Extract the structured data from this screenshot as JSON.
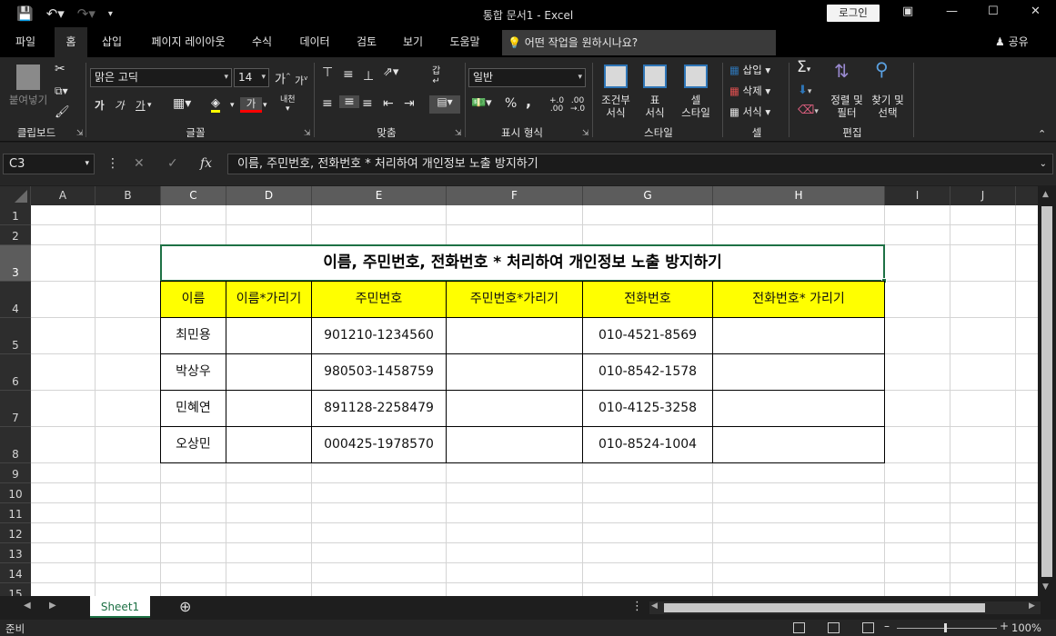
{
  "window": {
    "title": "통합 문서1  -  Excel",
    "login_label": "로그인"
  },
  "quick_access": {
    "icons": [
      "save-icon",
      "undo-icon",
      "redo-icon",
      "customize-icon"
    ]
  },
  "ribbon_tabs": [
    {
      "label": "파일"
    },
    {
      "label": "홈"
    },
    {
      "label": "삽입"
    },
    {
      "label": "페이지 레이아웃"
    },
    {
      "label": "수식"
    },
    {
      "label": "데이터"
    },
    {
      "label": "검토"
    },
    {
      "label": "보기"
    },
    {
      "label": "도움말"
    }
  ],
  "tell_me": "어떤 작업을 원하시나요?",
  "share_label": "공유",
  "ribbon": {
    "clipboard": {
      "paste": "붙여넣기",
      "group": "클립보드"
    },
    "font": {
      "name": "맑은 고딕",
      "size": "14",
      "bold": "가",
      "italic": "가",
      "underline": "가",
      "group": "글꼴",
      "phonetic": "내천"
    },
    "alignment": {
      "wrap": "갑",
      "group": "맞춤"
    },
    "number": {
      "format": "일반",
      "percent": "%",
      "comma": ",",
      "group": "표시 형식"
    },
    "styles": {
      "conditional": "조건부\n서식",
      "table": "표\n서식",
      "cell_style": "셀\n스타일",
      "group": "스타일"
    },
    "cells": {
      "insert": "삽입",
      "delete": "삭제",
      "format": "서식",
      "group": "셀"
    },
    "editing": {
      "sort": "정렬 및\n필터",
      "find": "찾기 및\n선택",
      "group": "편집"
    }
  },
  "formula_bar": {
    "name_box": "C3",
    "formula": "이름, 주민번호, 전화번호 * 처리하여 개인정보 노출 방지하기"
  },
  "columns": [
    "A",
    "B",
    "C",
    "D",
    "E",
    "F",
    "G",
    "H",
    "I",
    "J"
  ],
  "rows": [
    "1",
    "2",
    "3",
    "4",
    "5",
    "6",
    "7",
    "8",
    "9",
    "10",
    "11",
    "12",
    "13",
    "14",
    "15"
  ],
  "sheet": {
    "title": "이름, 주민번호, 전화번호 * 처리하여 개인정보 노출 방지하기",
    "headers": [
      "이름",
      "이름*가리기",
      "주민번호",
      "주민번호*가리기",
      "전화번호",
      "전화번호* 가리기"
    ],
    "records": [
      {
        "name": "최민용",
        "rrn": "901210-1234560",
        "phone": "010-4521-8569"
      },
      {
        "name": "박상우",
        "rrn": "980503-1458759",
        "phone": "010-8542-1578"
      },
      {
        "name": "민혜연",
        "rrn": "891128-2258479",
        "phone": "010-4125-3258"
      },
      {
        "name": "오상민",
        "rrn": "000425-1978570",
        "phone": "010-8524-1004"
      }
    ],
    "highlight_color": "#ffff00"
  },
  "sheet_tabs": [
    {
      "label": "Sheet1"
    }
  ],
  "status": {
    "ready": "준비",
    "zoom": "100%"
  },
  "colors": {
    "accent": "#1e7145",
    "ribbon_bg": "#262626",
    "titlebar_bg": "#000000"
  }
}
